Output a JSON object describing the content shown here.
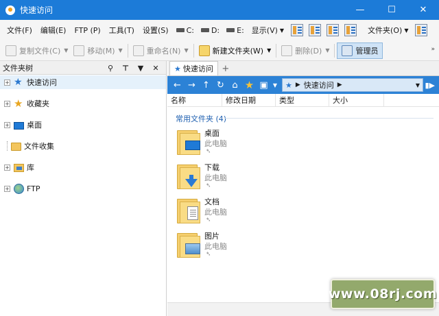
{
  "window": {
    "title": "快速访问",
    "min_icon": "minimize-icon",
    "max_icon": "maximize-icon",
    "close_icon": "close-icon"
  },
  "menu": {
    "items": [
      "文件(F)",
      "编辑(E)",
      "FTP (P)",
      "工具(T)",
      "设置(S)"
    ],
    "drives": [
      "C:",
      "D:",
      "E:"
    ],
    "display": "显示(V)",
    "folder": "文件夹(O)"
  },
  "toolbar": {
    "copy": "复制文件(C)",
    "move": "移动(M)",
    "rename": "重命名(N)",
    "new_folder": "新建文件夹(W)",
    "delete": "删除(D)",
    "admin": "管理员"
  },
  "tree": {
    "title": "文件夹树",
    "items": [
      {
        "label": "快速访问",
        "icon": "pin-icon"
      },
      {
        "label": "收藏夹",
        "icon": "star-icon"
      },
      {
        "label": "桌面",
        "icon": "desktop-icon"
      },
      {
        "label": "文件收集",
        "icon": "folder-icon"
      },
      {
        "label": "库",
        "icon": "library-icon"
      },
      {
        "label": "FTP",
        "icon": "globe-icon"
      }
    ]
  },
  "tabs": {
    "active": "快速访问",
    "add": "+"
  },
  "address": {
    "path": "快速访问"
  },
  "columns": [
    "名称",
    "修改日期",
    "类型",
    "大小"
  ],
  "group": {
    "title": "常用文件夹 (4)"
  },
  "files": [
    {
      "name": "桌面",
      "location": "此电脑"
    },
    {
      "name": "下载",
      "location": "此电脑"
    },
    {
      "name": "文档",
      "location": "此电脑"
    },
    {
      "name": "图片",
      "location": "此电脑"
    }
  ],
  "watermark": {
    "text": "www.08rj.com"
  }
}
